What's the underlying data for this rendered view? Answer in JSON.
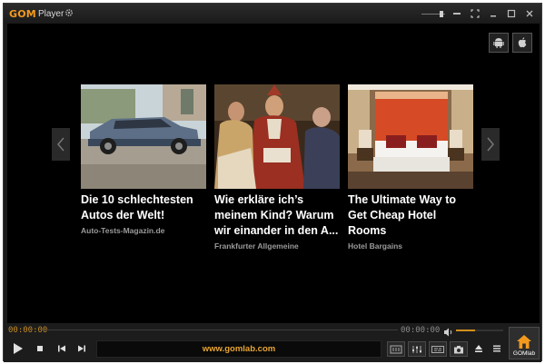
{
  "app": {
    "logo_gom": "GOM",
    "logo_player": "Player"
  },
  "ads": [
    {
      "headline": "Die 10 schlechtesten Autos der Welt!",
      "source": "Auto-Tests-Magazin.de"
    },
    {
      "headline": "Wie erkläre ich’s meinem Kind? Warum wir einander in den A...",
      "source": "Frankfurter Allgemeine"
    },
    {
      "headline": "The Ultimate Way to Get Cheap Hotel Rooms",
      "source": "Hotel Bargains"
    }
  ],
  "player": {
    "current_time": "00:00:00",
    "total_time": "00:00:00",
    "volume_percent": 40,
    "url_text": "www.gomlab.com",
    "gomlab_label": "GOMlab"
  },
  "colors": {
    "accent": "#f39a1e",
    "time_text": "#c58b25"
  }
}
